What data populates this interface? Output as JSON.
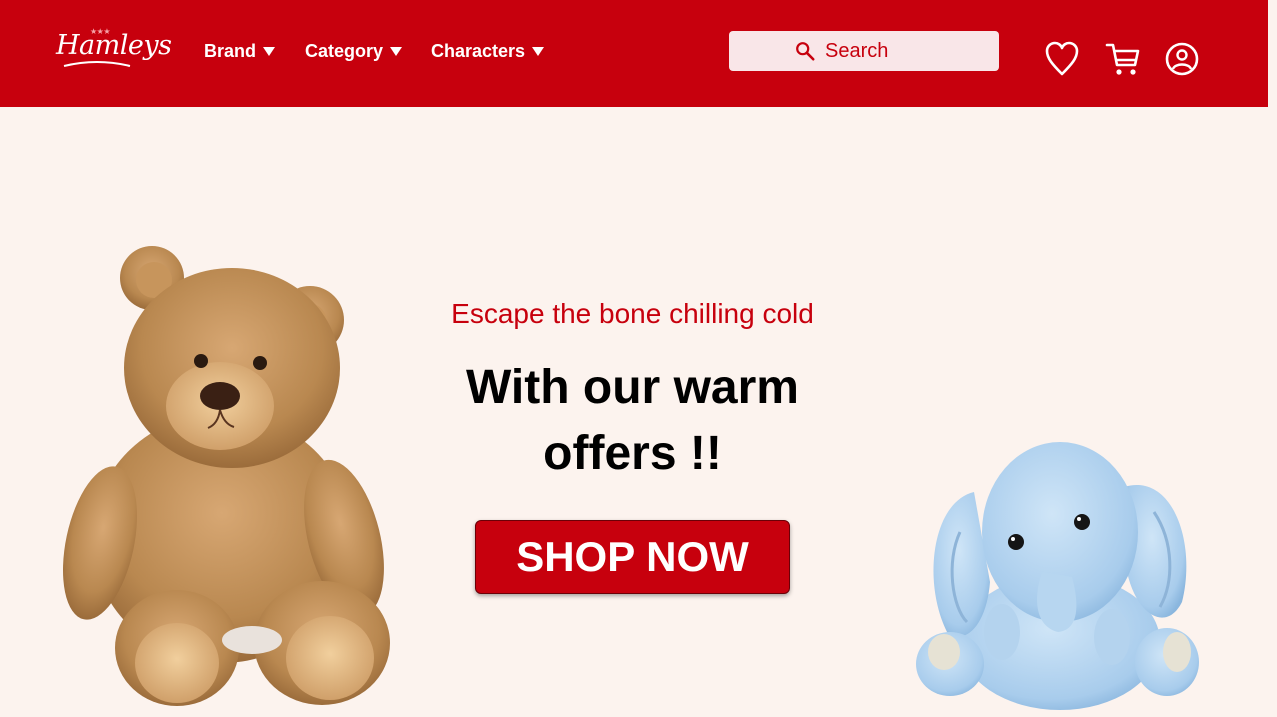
{
  "brand": {
    "logo_text": "Hamleys"
  },
  "nav": {
    "items": [
      {
        "label": "Brand"
      },
      {
        "label": "Category"
      },
      {
        "label": "Characters"
      }
    ]
  },
  "search": {
    "placeholder": "Search",
    "value": ""
  },
  "header_icons": [
    "heart-icon",
    "cart-icon",
    "user-icon"
  ],
  "hero": {
    "tagline": "Escape the bone chilling  cold",
    "headline_line1": "With our warm",
    "headline_line2": "offers !!",
    "cta_label": "SHOP NOW"
  },
  "colors": {
    "brand_red": "#c7000d",
    "page_background": "#fcf3ee",
    "search_background": "#f9e6e8"
  }
}
